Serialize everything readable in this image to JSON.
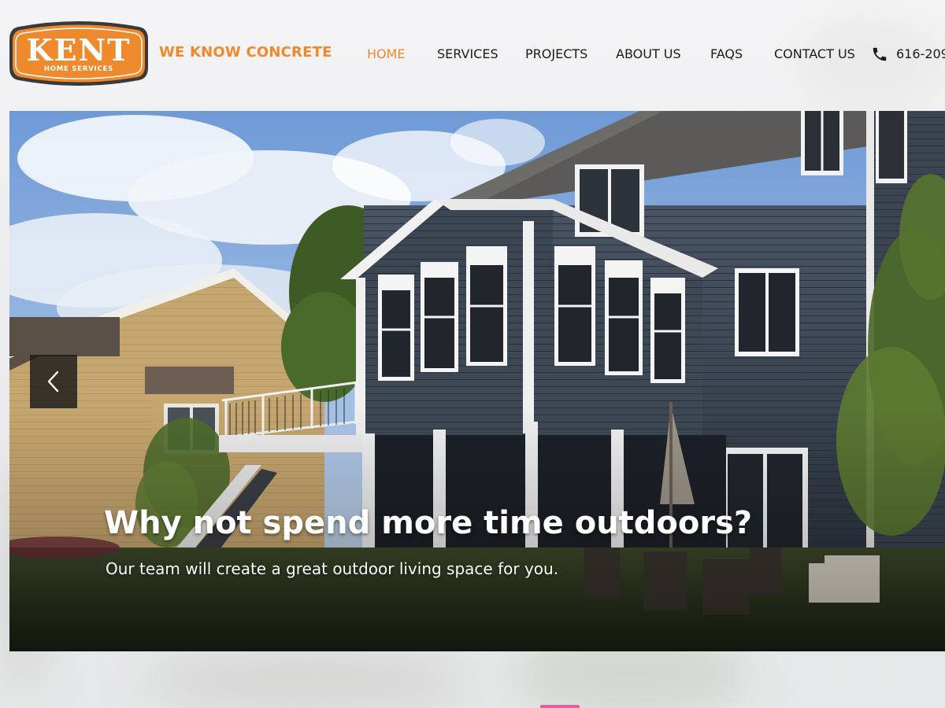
{
  "brand": {
    "logo_name": "KENT",
    "logo_sub": "HOME SERVICES",
    "tagline": "WE KNOW CONCRETE",
    "colors": {
      "accent": "#ee8a2d",
      "logo_bg": "#ee8a2d",
      "logo_border": "#3a3a3a",
      "nav_text": "#1b1b1b"
    }
  },
  "nav": {
    "items": [
      {
        "label": "HOME",
        "active": true
      },
      {
        "label": "SERVICES",
        "active": false
      },
      {
        "label": "PROJECTS",
        "active": false
      },
      {
        "label": "ABOUT US",
        "active": false
      },
      {
        "label": "FAQS",
        "active": false
      },
      {
        "label": "CONTACT US",
        "active": false
      }
    ]
  },
  "contact": {
    "icon": "phone-icon",
    "phone": "616-209-"
  },
  "hero": {
    "heading": "Why not spend more time outdoors?",
    "subheading": "Our team will create a great outdoor living space for you.",
    "prev_icon": "chevron-left-icon"
  }
}
